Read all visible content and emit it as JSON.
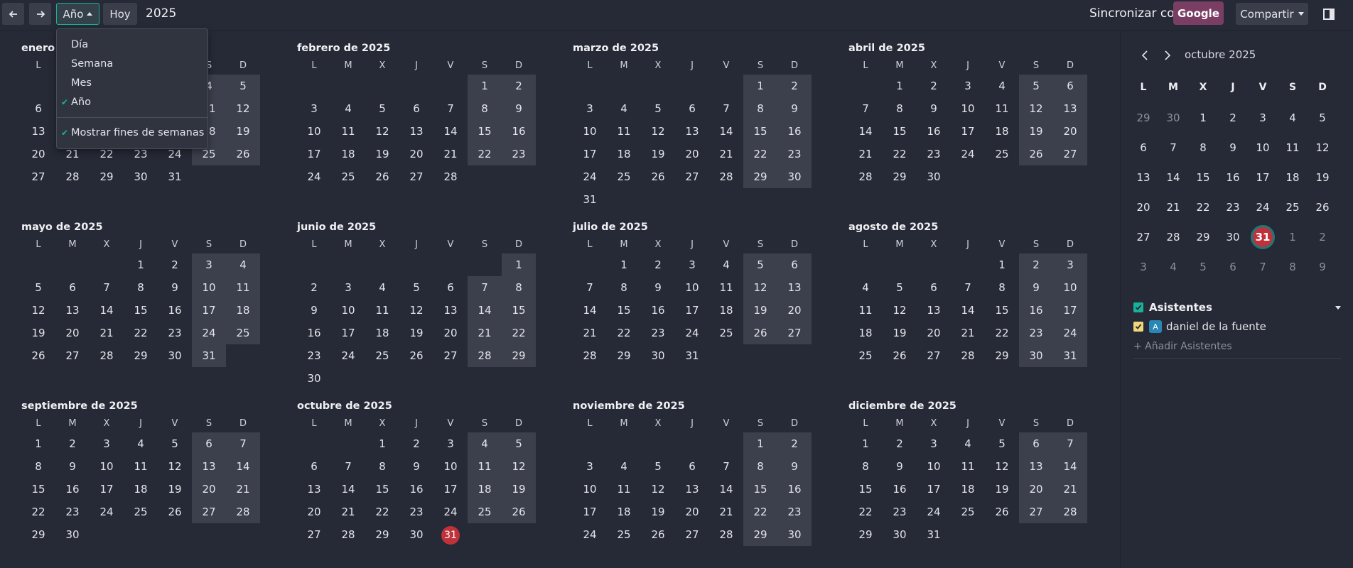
{
  "toolbar": {
    "scale_label": "Año",
    "today_label": "Hoy",
    "period": "2025",
    "sync_label": "Sincronizar con",
    "google_label": "Google",
    "share_label": "Compartir"
  },
  "scale_menu": {
    "items": [
      {
        "label": "Día",
        "checked": false
      },
      {
        "label": "Semana",
        "checked": false
      },
      {
        "label": "Mes",
        "checked": false
      },
      {
        "label": "Año",
        "checked": true
      }
    ],
    "weekends_label": "Mostrar fines de semanas",
    "weekends_checked": true
  },
  "weekday_labels": [
    "L",
    "M",
    "X",
    "J",
    "V",
    "S",
    "D"
  ],
  "months": [
    {
      "title": "enero de 2025",
      "offset": 2,
      "days": 31
    },
    {
      "title": "febrero de 2025",
      "offset": 5,
      "days": 28
    },
    {
      "title": "marzo de 2025",
      "offset": 5,
      "days": 31
    },
    {
      "title": "abril de 2025",
      "offset": 1,
      "days": 30
    },
    {
      "title": "mayo de 2025",
      "offset": 3,
      "days": 31
    },
    {
      "title": "junio de 2025",
      "offset": 6,
      "days": 30
    },
    {
      "title": "julio de 2025",
      "offset": 1,
      "days": 31
    },
    {
      "title": "agosto de 2025",
      "offset": 4,
      "days": 31
    },
    {
      "title": "septiembre de 2025",
      "offset": 0,
      "days": 30
    },
    {
      "title": "octubre de 2025",
      "offset": 2,
      "days": 31,
      "today": 31
    },
    {
      "title": "noviembre de 2025",
      "offset": 5,
      "days": 30
    },
    {
      "title": "diciembre de 2025",
      "offset": 0,
      "days": 31
    }
  ],
  "mini_calendar": {
    "title": "octubre 2025",
    "weekday_labels": [
      "L",
      "M",
      "X",
      "J",
      "V",
      "S",
      "D"
    ],
    "weeks": [
      [
        "29",
        "30",
        "1",
        "2",
        "3",
        "4",
        "5"
      ],
      [
        "6",
        "7",
        "8",
        "9",
        "10",
        "11",
        "12"
      ],
      [
        "13",
        "14",
        "15",
        "16",
        "17",
        "18",
        "19"
      ],
      [
        "20",
        "21",
        "22",
        "23",
        "24",
        "25",
        "26"
      ],
      [
        "27",
        "28",
        "29",
        "30",
        "31",
        "1",
        "2"
      ],
      [
        "3",
        "4",
        "5",
        "6",
        "7",
        "8",
        "9"
      ]
    ],
    "today": "31"
  },
  "attendees": {
    "title": "Asistentes",
    "people": [
      {
        "initial": "A",
        "name": "daniel de la fuente"
      }
    ],
    "add_label": "+ Añadir Asistentes"
  },
  "colors": {
    "accent": "#1ab09a",
    "today": "#c0313b",
    "google": "#7a3e64",
    "weekend_bg": "#3c404d"
  }
}
